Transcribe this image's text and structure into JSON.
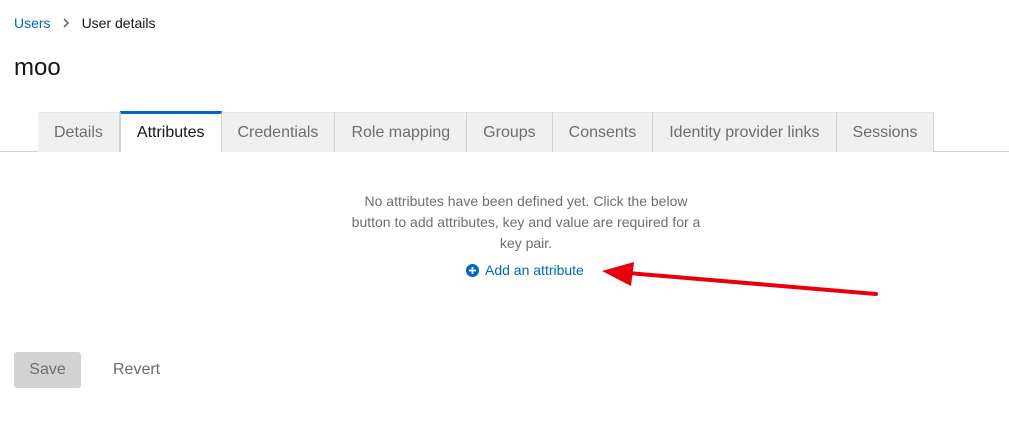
{
  "breadcrumb": {
    "parent": "Users",
    "current": "User details"
  },
  "page": {
    "title": "moo"
  },
  "tabs": [
    {
      "label": "Details",
      "active": false
    },
    {
      "label": "Attributes",
      "active": true
    },
    {
      "label": "Credentials",
      "active": false
    },
    {
      "label": "Role mapping",
      "active": false
    },
    {
      "label": "Groups",
      "active": false
    },
    {
      "label": "Consents",
      "active": false
    },
    {
      "label": "Identity provider links",
      "active": false
    },
    {
      "label": "Sessions",
      "active": false
    }
  ],
  "attributes": {
    "empty_message": "No attributes have been defined yet. Click the below button to add attributes, key and value are required for a key pair.",
    "add_label": "Add an attribute",
    "add_icon": "plus-circle-icon"
  },
  "actions": {
    "save_label": "Save",
    "revert_label": "Revert"
  },
  "colors": {
    "link": "#0066cc",
    "tab_active_border": "#0066cc",
    "annotation_arrow": "#e8000b"
  }
}
